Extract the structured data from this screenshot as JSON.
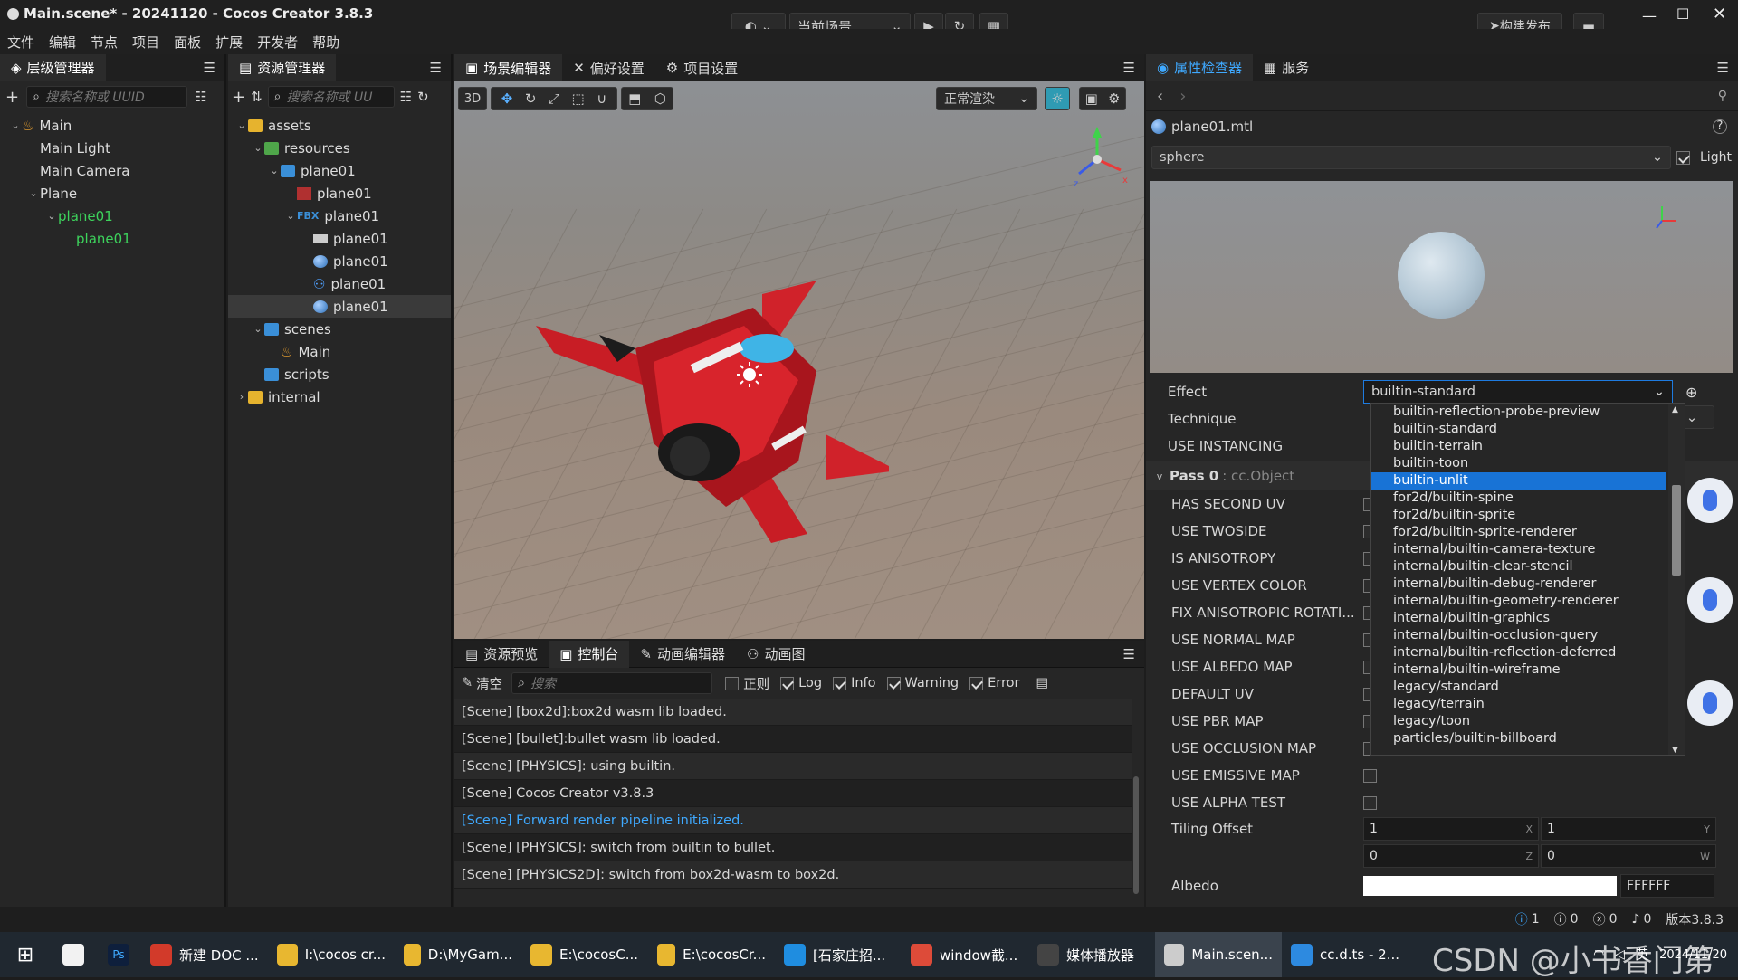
{
  "titlebar": {
    "title": "Main.scene* - 20241120 - Cocos Creator 3.8.3",
    "scene_select": "当前场景",
    "build_button": "构建发布"
  },
  "menu": [
    "文件",
    "编辑",
    "节点",
    "项目",
    "面板",
    "扩展",
    "开发者",
    "帮助"
  ],
  "hierarchy": {
    "tab": "层级管理器",
    "search_placeholder": "搜索名称或 UUID",
    "nodes": [
      {
        "label": "Main",
        "depth": 0,
        "caret": "v",
        "icon": "scene-icon"
      },
      {
        "label": "Main Light",
        "depth": 1,
        "caret": "",
        "icon": ""
      },
      {
        "label": "Main Camera",
        "depth": 1,
        "caret": "",
        "icon": ""
      },
      {
        "label": "Plane",
        "depth": 1,
        "caret": "v",
        "icon": ""
      },
      {
        "label": "plane01",
        "depth": 2,
        "caret": "v",
        "icon": "",
        "green": true
      },
      {
        "label": "plane01",
        "depth": 3,
        "caret": "",
        "icon": "",
        "green": true
      }
    ]
  },
  "assets": {
    "tab": "资源管理器",
    "search_placeholder": "搜索名称或 UU",
    "items": [
      {
        "label": "assets",
        "depth": 0,
        "caret": "v",
        "icon": "folder"
      },
      {
        "label": "resources",
        "depth": 1,
        "caret": "v",
        "icon": "folder-green"
      },
      {
        "label": "plane01",
        "depth": 2,
        "caret": "v",
        "icon": "folder-blue"
      },
      {
        "label": "plane01",
        "depth": 3,
        "caret": "",
        "icon": "texture"
      },
      {
        "label": "plane01",
        "depth": 3,
        "caret": "v",
        "icon": "fbx",
        "prefix": "FBX"
      },
      {
        "label": "plane01",
        "depth": 4,
        "caret": "",
        "icon": "mesh"
      },
      {
        "label": "plane01",
        "depth": 4,
        "caret": "",
        "icon": "material"
      },
      {
        "label": "plane01",
        "depth": 4,
        "caret": "",
        "icon": "prefab"
      },
      {
        "label": "plane01",
        "depth": 4,
        "caret": "",
        "icon": "material",
        "selected": true
      },
      {
        "label": "scenes",
        "depth": 1,
        "caret": "v",
        "icon": "folder-blue"
      },
      {
        "label": "Main",
        "depth": 2,
        "caret": "",
        "icon": "scene"
      },
      {
        "label": "scripts",
        "depth": 1,
        "caret": "",
        "icon": "folder-blue"
      },
      {
        "label": "internal",
        "depth": 0,
        "caret": ">",
        "icon": "folder"
      }
    ]
  },
  "scene_tabs": [
    "场景编辑器",
    "偏好设置",
    "项目设置"
  ],
  "scene_toolbar": {
    "mode3d": "3D",
    "render_mode": "正常渲染"
  },
  "bottom_tabs": [
    "资源预览",
    "控制台",
    "动画编辑器",
    "动画图"
  ],
  "console": {
    "clear": "清空",
    "search_placeholder": "搜索",
    "filters": [
      {
        "label": "正则",
        "on": false
      },
      {
        "label": "Log",
        "on": true
      },
      {
        "label": "Info",
        "on": true
      },
      {
        "label": "Warning",
        "on": true
      },
      {
        "label": "Error",
        "on": true
      }
    ],
    "lines": [
      {
        "text": "[Scene] [box2d]:box2d wasm lib loaded.",
        "info": false
      },
      {
        "text": "[Scene] [bullet]:bullet wasm lib loaded.",
        "info": false
      },
      {
        "text": "[Scene] [PHYSICS]: using builtin.",
        "info": false
      },
      {
        "text": "[Scene] Cocos Creator v3.8.3",
        "info": false
      },
      {
        "text": "[Scene] Forward render pipeline initialized.",
        "info": true
      },
      {
        "text": "[Scene] [PHYSICS]: switch from builtin to bullet.",
        "info": false
      },
      {
        "text": "[Scene] [PHYSICS2D]: switch from box2d-wasm to box2d.",
        "info": false
      }
    ]
  },
  "inspector": {
    "tabs": [
      "属性检查器",
      "服务"
    ],
    "file": "plane01.mtl",
    "preview_mesh": "sphere",
    "light_label": "Light",
    "effect_label": "Effect",
    "effect_value": "builtin-standard",
    "props_top": [
      "Technique",
      "USE INSTANCING"
    ],
    "pass_label": "Pass 0",
    "pass_type": ": cc.Object",
    "pass_props": [
      "HAS SECOND UV",
      "USE TWOSIDE",
      "IS ANISOTROPY",
      "USE VERTEX COLOR",
      "FIX ANISOTROPIC ROTATI...",
      "USE NORMAL MAP",
      "USE ALBEDO MAP",
      "DEFAULT UV",
      "USE PBR MAP",
      "USE OCCLUSION MAP",
      "USE EMISSIVE MAP",
      "USE ALPHA TEST"
    ],
    "tiling_label": "Tiling Offset",
    "tiling": [
      {
        "v": "1",
        "ax": "X"
      },
      {
        "v": "1",
        "ax": "Y"
      },
      {
        "v": "0",
        "ax": "Z"
      },
      {
        "v": "0",
        "ax": "W"
      }
    ],
    "albedo_label": "Albedo",
    "albedo_hex": "FFFFFF",
    "dropdown": [
      "builtin-reflection-probe-preview",
      "builtin-standard",
      "builtin-terrain",
      "builtin-toon",
      "builtin-unlit",
      "for2d/builtin-spine",
      "for2d/builtin-sprite",
      "for2d/builtin-sprite-renderer",
      "internal/builtin-camera-texture",
      "internal/builtin-clear-stencil",
      "internal/builtin-debug-renderer",
      "internal/builtin-geometry-renderer",
      "internal/builtin-graphics",
      "internal/builtin-occlusion-query",
      "internal/builtin-reflection-deferred",
      "internal/builtin-wireframe",
      "legacy/standard",
      "legacy/terrain",
      "legacy/toon",
      "particles/builtin-billboard"
    ],
    "dropdown_selected": 4
  },
  "statusbar": {
    "info": "1",
    "warn": "0",
    "err": "0",
    "bell": "0",
    "version": "版本3.8.3"
  },
  "taskbar": [
    {
      "label": "新建 DOC ...",
      "color": "#d23a2a"
    },
    {
      "label": "I:\\cocos cr...",
      "color": "#e8b730"
    },
    {
      "label": "D:\\MyGam...",
      "color": "#e8b730"
    },
    {
      "label": "E:\\cocosC...",
      "color": "#e8b730"
    },
    {
      "label": "E:\\cocosCr...",
      "color": "#e8b730"
    },
    {
      "label": "[石家庄招...",
      "color": "#1f8de0"
    },
    {
      "label": "window截...",
      "color": "#dd4b39"
    },
    {
      "label": "媒体播放器",
      "color": "#444444"
    },
    {
      "label": "Main.scen...",
      "color": "#cccccc",
      "active": true
    },
    {
      "label": "cc.d.ts - 2...",
      "color": "#2d8ae0"
    }
  ],
  "tray": {
    "ime": "英",
    "time": "2024/11/20",
    "watermark": "CSDN @小书香门第"
  }
}
